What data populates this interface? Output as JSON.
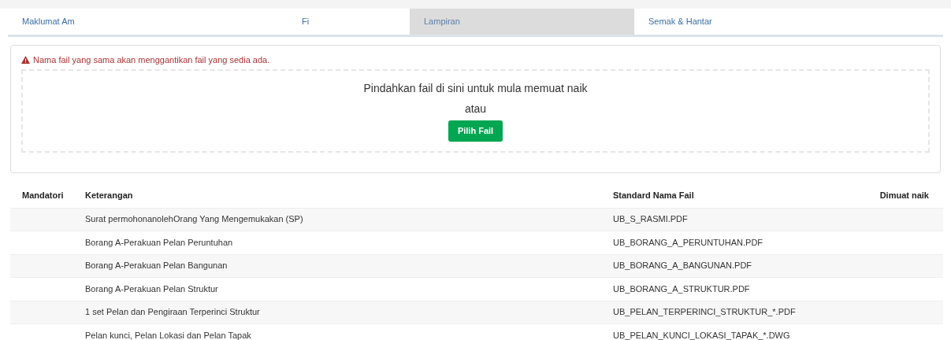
{
  "tabs": [
    {
      "label": "Maklumat Am",
      "selected": false
    },
    {
      "label": "Fi",
      "selected": false
    },
    {
      "label": "Lampiran",
      "selected": true
    },
    {
      "label": "Semak & Hantar",
      "selected": false
    }
  ],
  "upload": {
    "warning": "Nama fail yang sama akan menggantikan fail yang sedia ada.",
    "drop_text": "Pindahkan fail di sini untuk mula memuat naik",
    "or_text": "atau",
    "button": "Pilih Fail"
  },
  "table": {
    "columns": [
      "Mandatori",
      "Keterangan",
      "Standard Nama Fail",
      "Dimuat naik"
    ],
    "rows": [
      {
        "description": "Surat permohonanolehOrang Yang Mengemukakan (SP)",
        "file_name": "UB_S_RASMI.PDF"
      },
      {
        "description": "Borang A-Perakuan Pelan Peruntuhan",
        "file_name": "UB_BORANG_A_PERUNTUHAN.PDF"
      },
      {
        "description": "Borang A-Perakuan Pelan Bangunan",
        "file_name": "UB_BORANG_A_BANGUNAN.PDF"
      },
      {
        "description": "Borang A-Perakuan Pelan Struktur",
        "file_name": "UB_BORANG_A_STRUKTUR.PDF"
      },
      {
        "description": "1 set Pelan dan Pengiraan Terperinci Struktur",
        "file_name": "UB_PELAN_TERPERINCI_STRUKTUR_*.PDF"
      },
      {
        "description": "Pelan kunci, Pelan Lokasi dan Pelan Tapak",
        "file_name": "UB_PELAN_KUNCI_LOKASI_TAPAK_*.DWG"
      }
    ]
  }
}
